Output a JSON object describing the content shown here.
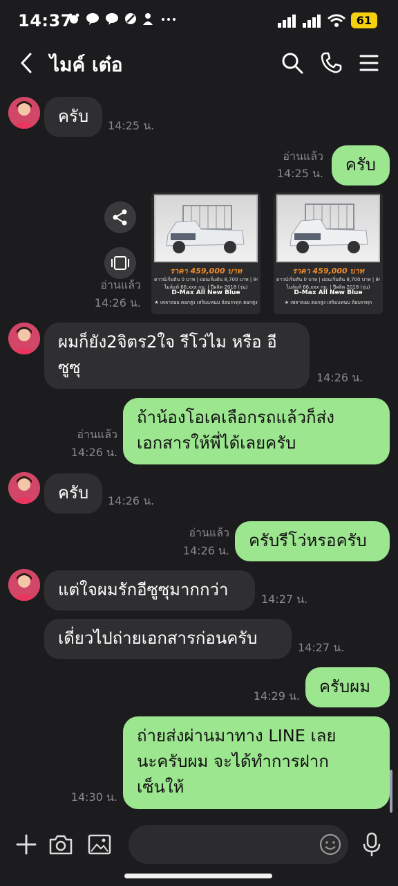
{
  "status": {
    "time": "14:37",
    "battery": "61"
  },
  "header": {
    "title": "ไมค์ เต๋อ"
  },
  "messages": {
    "m1": {
      "text": "ครับ",
      "time": "14:25 น."
    },
    "m2": {
      "text": "ครับ",
      "read": "อ่านแล้ว",
      "time": "14:25 น."
    },
    "m3": {
      "read": "อ่านแล้ว",
      "time": "14:26 น.",
      "images": [
        {
          "price": "ราคา 459,000 บาท",
          "line1": "ดาวน์เริ่มต้น 0 บาท | ผ่อนเริ่มต้น 8,700 บาท | 84 งวด",
          "line2": "ไมล์แท้ 66,xxx กม. | ปีผลิต 2018 (รุ่น)",
          "model": "D-Max All New Blue",
          "footer": "★ เพลาลอย ดอกสูง เสริมแหนบ ล้อบรรทุก ตอกสูง"
        },
        {
          "price": "ราคา 459,000 บาท",
          "line1": "ดาวน์เริ่มต้น 0 บาท | ผ่อนเริ่มต้น 8,700 บาท | 84 งวด",
          "line2": "ไมล์แท้ 66,xxx กม. | ปีผลิต 2018 (รุ่น)",
          "model": "D-Max All New Blue",
          "footer": "★ เพลาลอย ดอกสูง เสริมแหนบ ล้อบรรทุก"
        }
      ]
    },
    "m4": {
      "text": "ผมก็ยัง2จิตร2ใจ รีโว่ไม หรือ อี\nซูซุ",
      "time": "14:26 น."
    },
    "m5": {
      "text": "ถ้าน้องโอเคเลือกรถแล้วก็ส่ง\nเอกสารให้พี่ได้เลยครับ",
      "read": "อ่านแล้ว",
      "time": "14:26 น."
    },
    "m6": {
      "text": "ครับ",
      "time": "14:26 น."
    },
    "m7": {
      "text": "ครับรีโว่หรอครับ",
      "read": "อ่านแล้ว",
      "time": "14:26 น."
    },
    "m8": {
      "text": "แต่ใจผมรักอีซูซุมากกว่า",
      "time": "14:27 น."
    },
    "m9": {
      "text": "เดี่ยวไปถ่ายเอกสารก่อนครับ",
      "time": "14:27 น."
    },
    "m10": {
      "text": "ครับผม",
      "time": "14:29 น."
    },
    "m11": {
      "text": "ถ่ายส่งผ่านมาทาง LINE เลย\nนะครับผม จะได้ทำการฝาก\nเซ็นให้",
      "time": "14:30 น."
    }
  },
  "icons": {
    "back": "chevron-left-icon",
    "search": "search-icon",
    "call": "phone-icon",
    "menu": "menu-icon",
    "share": "share-icon",
    "gallery": "album-icon",
    "plus": "plus-icon",
    "camera": "camera-icon",
    "image": "image-icon",
    "emoji": "emoji-icon",
    "mic": "microphone-icon"
  },
  "colors": {
    "background": "#1c1c1e",
    "incoming_bubble": "#2f2f31",
    "outgoing_bubble": "#9de690",
    "battery": "#f5d10e"
  }
}
